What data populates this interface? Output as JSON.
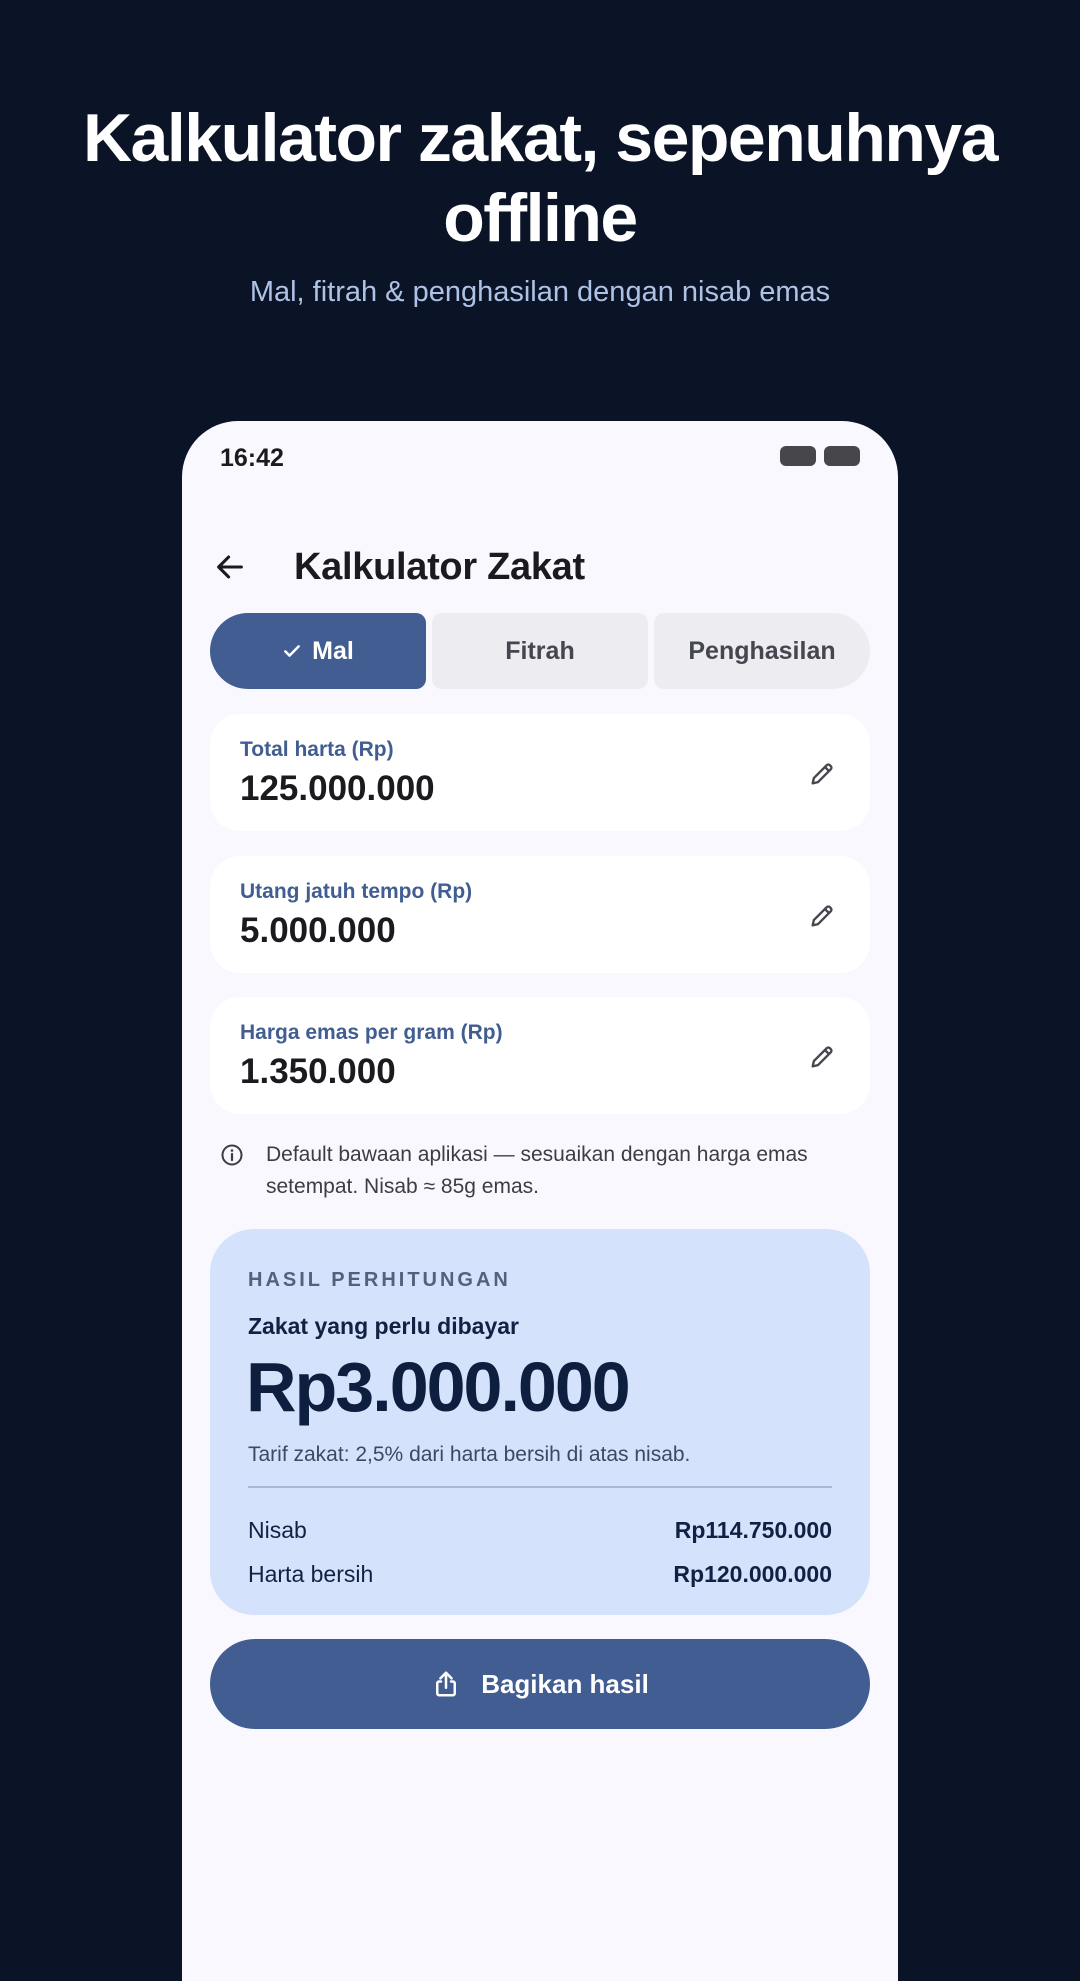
{
  "promo": {
    "headline": "Kalkulator zakat, sepenuhnya offline",
    "subtitle": "Mal, fitrah & penghasilan dengan nisab emas"
  },
  "status_bar": {
    "time": "16:42"
  },
  "app_bar": {
    "title": "Kalkulator Zakat",
    "back_icon": "arrow-left-icon"
  },
  "tabs": [
    {
      "label": "Mal",
      "selected": true
    },
    {
      "label": "Fitrah",
      "selected": false
    },
    {
      "label": "Penghasilan",
      "selected": false
    }
  ],
  "fields": {
    "total_harta": {
      "label": "Total harta (Rp)",
      "value": "125.000.000"
    },
    "utang": {
      "label": "Utang jatuh tempo (Rp)",
      "value": "5.000.000"
    },
    "harga_emas": {
      "label": "Harga emas per gram (Rp)",
      "value": "1.350.000"
    }
  },
  "info": {
    "text": "Default bawaan aplikasi — sesuaikan dengan harga emas setempat. Nisab ≈ 85g emas.",
    "icon": "info-icon"
  },
  "result": {
    "overline": "HASIL PERHITUNGAN",
    "caption": "Zakat yang perlu dibayar",
    "amount": "Rp3.000.000",
    "note": "Tarif zakat: 2,5% dari harta bersih di atas nisab.",
    "rows": [
      {
        "label": "Nisab",
        "value": "Rp114.750.000"
      },
      {
        "label": "Harta bersih",
        "value": "Rp120.000.000"
      }
    ]
  },
  "share_button": {
    "label": "Bagikan hasil",
    "icon": "share-icon"
  },
  "colors": {
    "background": "#0b1326",
    "primary": "#415d91",
    "surface": "#f8f8fe",
    "result_card": "#d5e2fc"
  }
}
